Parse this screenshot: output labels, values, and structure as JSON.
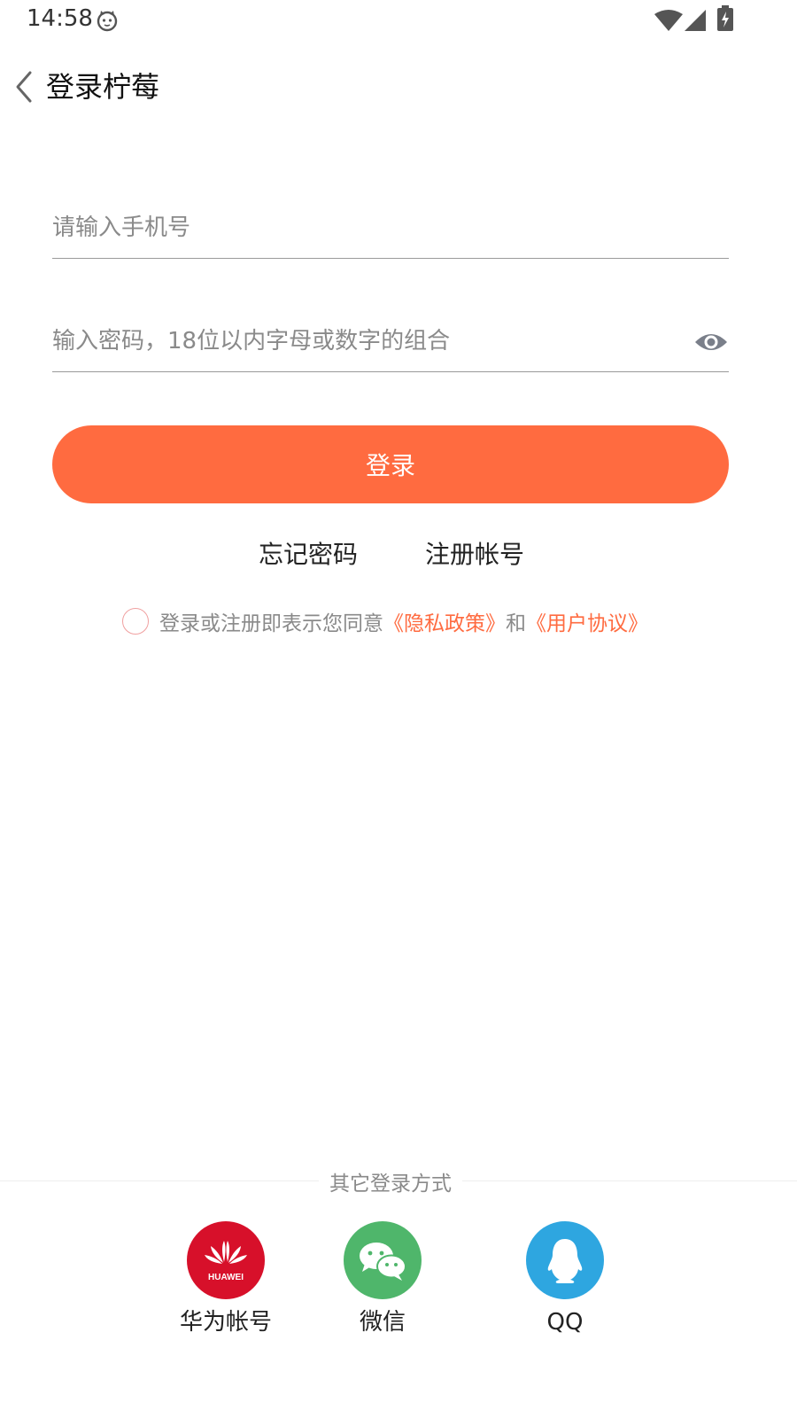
{
  "status_bar": {
    "time": "14:58"
  },
  "header": {
    "title": "登录柠莓",
    "back_icon": "back-arrow-icon"
  },
  "form": {
    "phone_placeholder": "请输入手机号",
    "phone_value": "",
    "password_placeholder": "输入密码，18位以内字母或数字的组合",
    "password_value": "",
    "eye_icon": "eye-icon",
    "login_label": "登录"
  },
  "links": {
    "forgot": "忘记密码",
    "register": "注册帐号"
  },
  "agreement": {
    "checked": false,
    "text": "登录或注册即表示您同意",
    "privacy": "《隐私政策》",
    "and": "和",
    "terms": "《用户协议》"
  },
  "other_login": {
    "label": "其它登录方式",
    "options": [
      {
        "label": "华为帐号",
        "icon": "huawei-logo-icon",
        "color": "#d7102a",
        "badge": "HUAWEI"
      },
      {
        "label": "微信",
        "icon": "wechat-icon",
        "color": "#4fb66b"
      },
      {
        "label": "QQ",
        "icon": "qq-penguin-icon",
        "color": "#2ea6e0"
      }
    ]
  },
  "colors": {
    "accent": "#ff6b40",
    "muted_text": "#8a8a8a",
    "checkbox_border": "#f0a0a0"
  }
}
